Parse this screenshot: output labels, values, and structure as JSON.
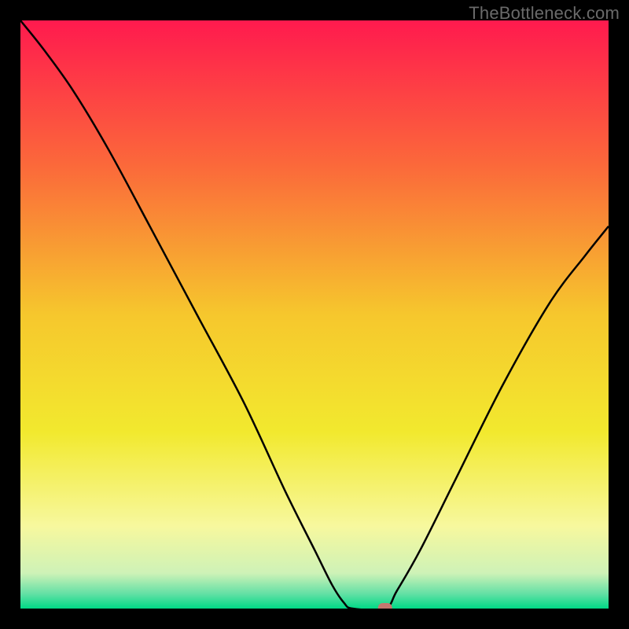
{
  "watermark": "TheBottleneck.com",
  "chart_data": {
    "type": "line",
    "title": "",
    "xlabel": "",
    "ylabel": "",
    "xlim": [
      0,
      100
    ],
    "ylim": [
      0,
      100
    ],
    "grid": false,
    "legend": false,
    "background": {
      "type": "vertical-gradient",
      "stops": [
        {
          "offset": 0.0,
          "color": "#ff1a4e"
        },
        {
          "offset": 0.25,
          "color": "#fb6a3a"
        },
        {
          "offset": 0.5,
          "color": "#f6c72d"
        },
        {
          "offset": 0.7,
          "color": "#f2e92e"
        },
        {
          "offset": 0.86,
          "color": "#f7f89e"
        },
        {
          "offset": 0.94,
          "color": "#cef2b7"
        },
        {
          "offset": 0.975,
          "color": "#63e0a5"
        },
        {
          "offset": 1.0,
          "color": "#00d986"
        }
      ]
    },
    "series": [
      {
        "name": "curve",
        "color": "#000000",
        "points": [
          {
            "x": 0.0,
            "y": 100.0
          },
          {
            "x": 4.0,
            "y": 95.0
          },
          {
            "x": 9.0,
            "y": 88.0
          },
          {
            "x": 15.0,
            "y": 78.0
          },
          {
            "x": 22.0,
            "y": 65.0
          },
          {
            "x": 30.0,
            "y": 50.0
          },
          {
            "x": 38.0,
            "y": 35.0
          },
          {
            "x": 45.0,
            "y": 20.0
          },
          {
            "x": 50.0,
            "y": 10.0
          },
          {
            "x": 53.0,
            "y": 4.0
          },
          {
            "x": 55.0,
            "y": 1.0
          },
          {
            "x": 56.5,
            "y": 0.0
          },
          {
            "x": 62.0,
            "y": 0.0
          },
          {
            "x": 64.0,
            "y": 3.0
          },
          {
            "x": 68.0,
            "y": 10.0
          },
          {
            "x": 74.0,
            "y": 22.0
          },
          {
            "x": 82.0,
            "y": 38.0
          },
          {
            "x": 90.0,
            "y": 52.0
          },
          {
            "x": 96.0,
            "y": 60.0
          },
          {
            "x": 100.0,
            "y": 65.0
          }
        ]
      }
    ],
    "marker": {
      "x": 62.0,
      "y": 0.0,
      "color": "#c3786f",
      "shape": "rounded-rect"
    }
  }
}
